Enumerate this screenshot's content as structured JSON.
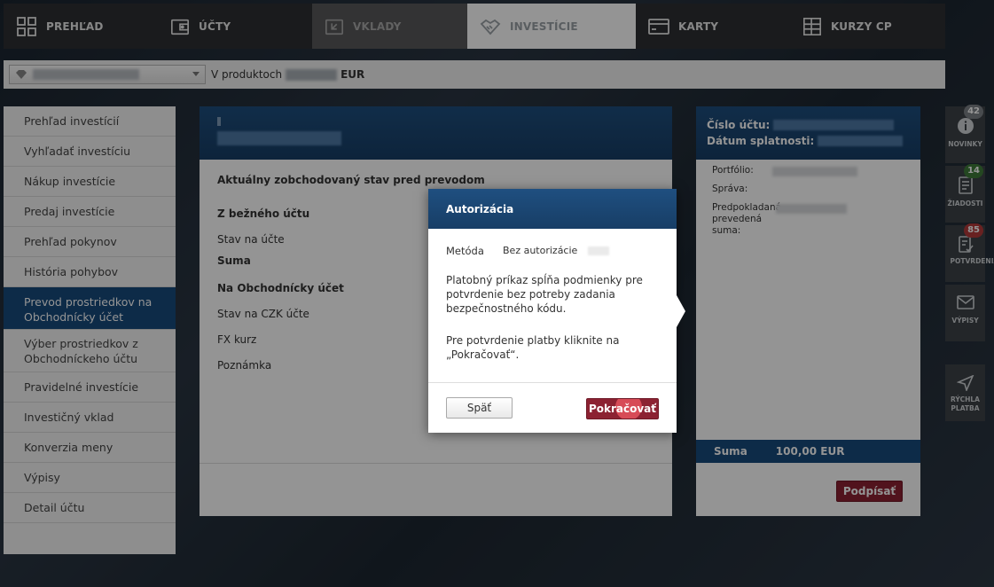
{
  "nav": {
    "tabs": [
      {
        "label": "PREHĽAD",
        "icon": "grid-icon"
      },
      {
        "label": "ÚČTY",
        "icon": "wallet-icon"
      },
      {
        "label": "VKLADY",
        "icon": "deposit-icon"
      },
      {
        "label": "INVESTÍCIE",
        "icon": "handshake-icon"
      },
      {
        "label": "KARTY",
        "icon": "card-icon"
      },
      {
        "label": "KURZY CP",
        "icon": "table-icon"
      }
    ]
  },
  "product_bar": {
    "label": "V produktoch",
    "currency": "EUR"
  },
  "sidebar": {
    "items": [
      {
        "label": "Prehľad investícií"
      },
      {
        "label": "Vyhľadať investíciu"
      },
      {
        "label": "Nákup investície"
      },
      {
        "label": "Predaj investície"
      },
      {
        "label": "Prehľad pokynov"
      },
      {
        "label": "História pohybov"
      },
      {
        "label": "Prevod prostriedkov na Obchodnícky účet"
      },
      {
        "label": "Výber prostriedkov z Obchodníckeho účtu"
      },
      {
        "label": "Pravidelné investície"
      },
      {
        "label": "Investičný vklad"
      },
      {
        "label": "Konverzia meny"
      },
      {
        "label": "Výpisy"
      },
      {
        "label": "Detail účtu"
      }
    ]
  },
  "main": {
    "heading": "Aktuálny zobchodovaný stav pred prevodom",
    "from_section": "Z bežného účtu",
    "balance_label": "Stav na účte",
    "sum_label": "Suma",
    "to_section": "Na Obchodnícky účet",
    "czk_balance_label": "Stav na CZK účte",
    "fx_label": "FX kurz",
    "note_label": "Poznámka"
  },
  "right": {
    "account_label": "Číslo účtu:",
    "due_label": "Dátum splatnosti:",
    "portfolio_label": "Portfólio:",
    "message_label": "Správa:",
    "expected_label": "Predpokladaná prevedená suma:",
    "sum_label": "Suma",
    "sum_value": "100,00 EUR",
    "sign_button": "Podpísať"
  },
  "rail": {
    "items": [
      {
        "label": "NOVINKY",
        "badge": "42",
        "badge_color": "#7d8287",
        "icon": "info-icon"
      },
      {
        "label": "ŽIADOSTI",
        "badge": "14",
        "badge_color": "#3f7a3a",
        "icon": "document-icon"
      },
      {
        "label": "POTVRDENIA",
        "badge": "85",
        "badge_color": "#b33a3a",
        "icon": "confirm-icon"
      },
      {
        "label": "VÝPISY",
        "badge": "",
        "icon": "envelope-icon"
      },
      {
        "label": "RÝCHLA PLATBA",
        "badge": "",
        "icon": "send-icon"
      }
    ]
  },
  "modal": {
    "title": "Autorizácia",
    "method_label": "Metóda",
    "method_value": "Bez autorizácie",
    "text1": "Platobný príkaz spĺňa podmienky pre potvrdenie bez potreby zadania bezpečnostného kódu.",
    "text2": "Pre potvrdenie platby kliknite na „Pokračovať“.",
    "back_button": "Späť",
    "continue_button": "Pokračovať"
  },
  "colors": {
    "accent_blue": "#174a7c",
    "accent_red": "#8c2232"
  }
}
